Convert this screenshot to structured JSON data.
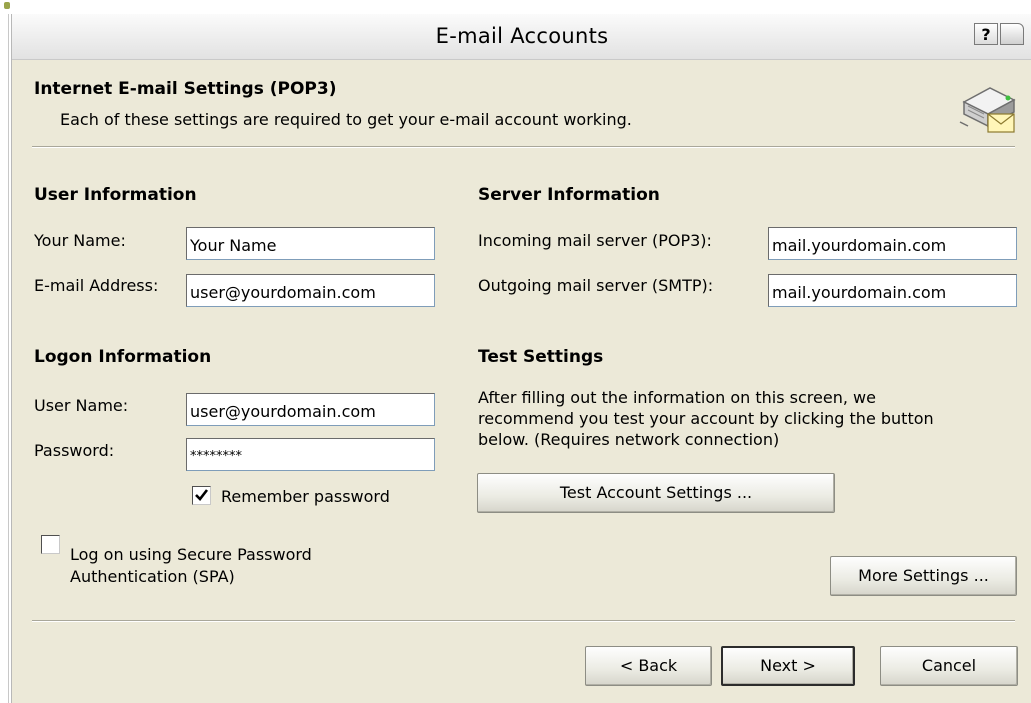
{
  "window": {
    "title": "E-mail Accounts",
    "help_glyph": "?"
  },
  "header": {
    "title": "Internet E-mail Settings (POP3)",
    "subtitle": "Each of these settings are required to get your e-mail account working.",
    "icon": "mail-server-icon"
  },
  "user_info": {
    "heading": "User Information",
    "name_label": "Your Name:",
    "name_value": "Your Name",
    "email_label": "E-mail Address:",
    "email_value": "user@yourdomain.com"
  },
  "server_info": {
    "heading": "Server Information",
    "incoming_label": "Incoming mail server (POP3):",
    "incoming_value": "mail.yourdomain.com",
    "outgoing_label": "Outgoing mail server (SMTP):",
    "outgoing_value": "mail.yourdomain.com"
  },
  "logon_info": {
    "heading": "Logon Information",
    "user_label": "User Name:",
    "user_value": "user@yourdomain.com",
    "password_label": "Password:",
    "password_value": "********",
    "remember_label": "Remember password",
    "remember_checked": true,
    "spa_label_line1": "Log on using Secure Password",
    "spa_label_line2": "Authentication (SPA)",
    "spa_checked": false
  },
  "test_settings": {
    "heading": "Test Settings",
    "desc_line1": "After filling out the information on this screen, we",
    "desc_line2": "recommend you test your account by clicking the button",
    "desc_line3": "below. (Requires network connection)",
    "button": "Test Account Settings ..."
  },
  "buttons": {
    "more_settings": "More Settings ...",
    "back": "< Back",
    "next": "Next >",
    "cancel": "Cancel"
  },
  "colors": {
    "dialog_bg": "#ece9d8",
    "field_border": "#7f9db9"
  }
}
